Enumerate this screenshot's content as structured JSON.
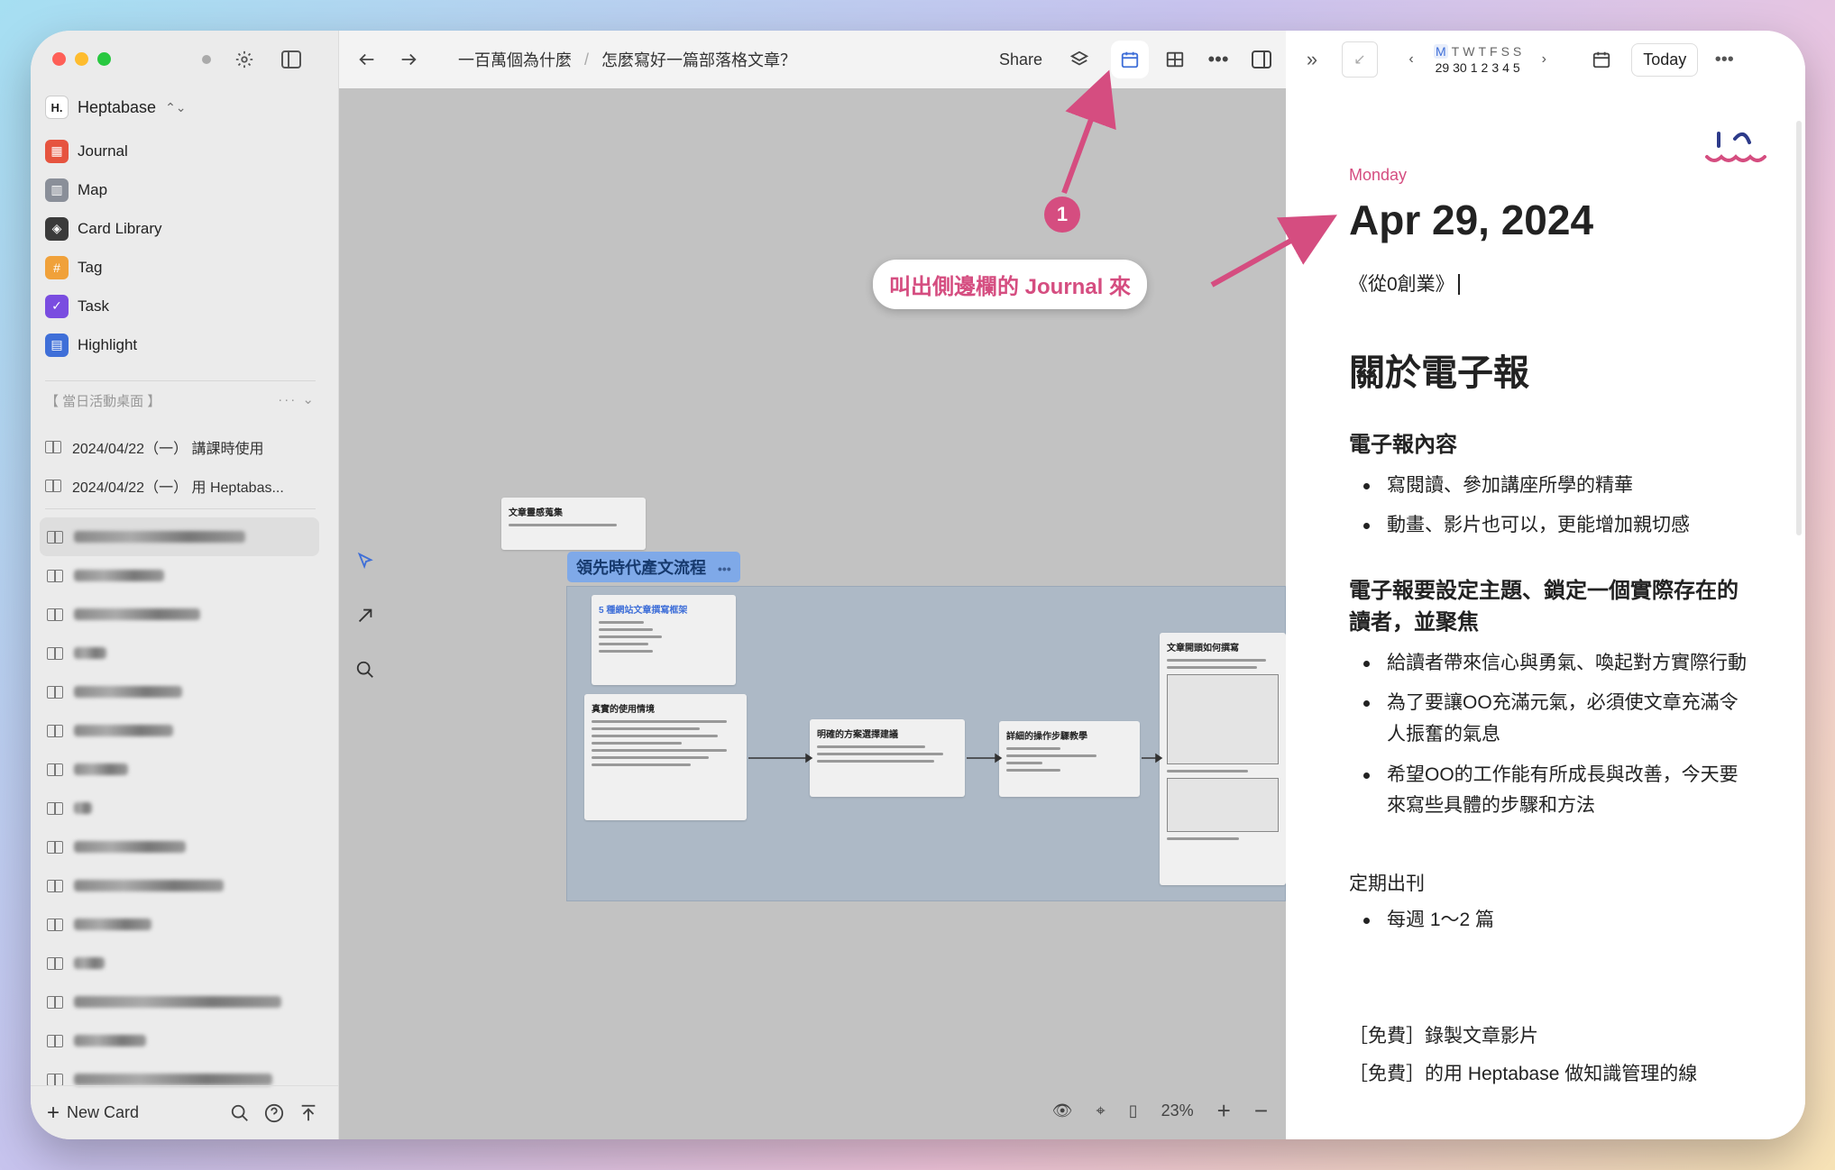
{
  "sidebar": {
    "workspace": "Heptabase",
    "nav": [
      {
        "label": "Journal",
        "icon": "calendar-icon",
        "color": "#e6543f"
      },
      {
        "label": "Map",
        "icon": "map-icon",
        "color": "#8a8f99"
      },
      {
        "label": "Card Library",
        "icon": "layers-icon",
        "color": "#3a3a3a"
      },
      {
        "label": "Tag",
        "icon": "hash-icon",
        "color": "#f0a13a"
      },
      {
        "label": "Task",
        "icon": "check-icon",
        "color": "#7a4de0"
      },
      {
        "label": "Highlight",
        "icon": "highlight-icon",
        "color": "#3f6fd8"
      }
    ],
    "section_title": "【 當日活動桌面 】",
    "pinned": [
      {
        "label": "2024/04/22（一） 講課時使用"
      },
      {
        "label": "2024/04/22（一） 用 Heptabas..."
      }
    ],
    "new_card": "New Card"
  },
  "topbar": {
    "crumb1": "一百萬個為什麼",
    "crumb_sep": "/",
    "crumb2": "怎麼寫好一篇部落格文章？",
    "share": "Share"
  },
  "canvas": {
    "top_card_title": "文章靈感蒐集",
    "section_label": "領先時代產文流程",
    "card1_title": "5 種網站文章撰寫框架",
    "card2_title": "真實的使用情境",
    "card3_title": "明確的方案選擇建議",
    "card4_title": "詳細的操作步驟教學",
    "card5_title": "文章開頭如何撰寫",
    "zoom": "23%"
  },
  "journal": {
    "week_dow": [
      "M",
      "T",
      "W",
      "T",
      "F",
      "S",
      "S"
    ],
    "week_dom": [
      "29",
      "30",
      "1",
      "2",
      "3",
      "4",
      "5"
    ],
    "today": "Today",
    "day_name": "Monday",
    "date": "Apr 29, 2024",
    "line1": "《從0創業》",
    "h1": "關於電子報",
    "h2a": "電子報內容",
    "list_a": [
      "寫閱讀、參加講座所學的精華",
      "動畫、影片也可以，更能增加親切感"
    ],
    "h2b": "電子報要設定主題、鎖定一個實際存在的讀者，並聚焦",
    "list_b": [
      "給讀者帶來信心與勇氣、喚起對方實際行動",
      "為了要讓OO充滿元氣，必須使文章充滿令人振奮的氣息",
      "希望OO的工作能有所成長與改善，今天要來寫些具體的步驟和方法"
    ],
    "para1": "定期出刊",
    "list_c": [
      "每週 1～2 篇"
    ],
    "free1": "［免費］錄製文章影片",
    "free2": "［免費］的用 Heptabase 做知識管理的線"
  },
  "annotation": {
    "number": "1",
    "text": "叫出側邊欄的 Journal 來"
  }
}
